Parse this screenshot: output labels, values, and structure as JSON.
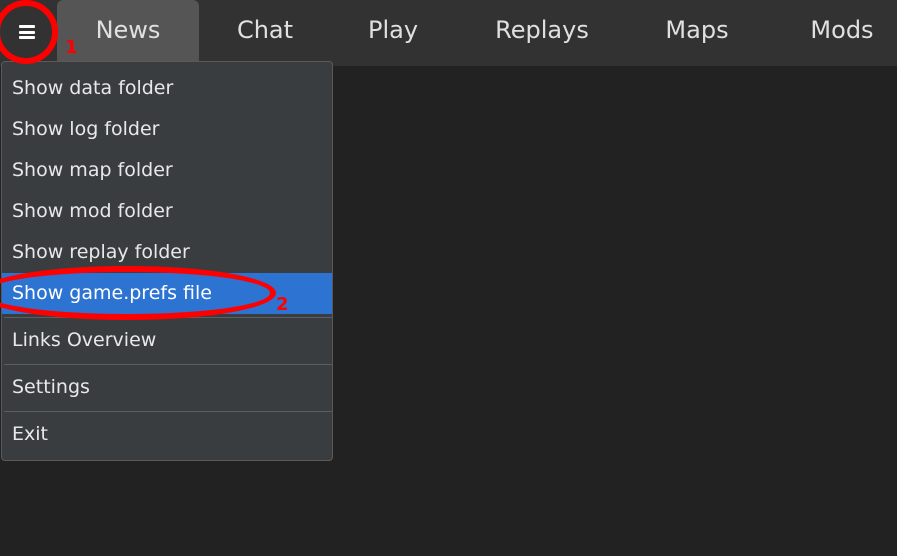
{
  "topbar": {
    "menu_icon": "hamburger-menu-icon",
    "tabs": [
      {
        "label": "News",
        "active": true
      },
      {
        "label": "Chat",
        "active": false
      },
      {
        "label": "Play",
        "active": false
      },
      {
        "label": "Replays",
        "active": false
      },
      {
        "label": "Maps",
        "active": false
      },
      {
        "label": "Mods",
        "active": false
      }
    ]
  },
  "menu": {
    "items": [
      {
        "label": "Show data folder"
      },
      {
        "label": "Show log folder"
      },
      {
        "label": "Show map folder"
      },
      {
        "label": "Show mod folder"
      },
      {
        "label": "Show replay folder"
      },
      {
        "label": "Show game.prefs file",
        "highlighted": true
      },
      {
        "label": "Links Overview"
      },
      {
        "label": "Settings"
      },
      {
        "label": "Exit"
      }
    ]
  },
  "annotations": [
    {
      "label": "1"
    },
    {
      "label": "2"
    }
  ],
  "colors": {
    "background": "#222222",
    "topbar": "#323232",
    "active_tab": "#555555",
    "menu_bg": "#3a3d40",
    "highlight": "#2c73d2",
    "annotation": "#ff0000"
  }
}
